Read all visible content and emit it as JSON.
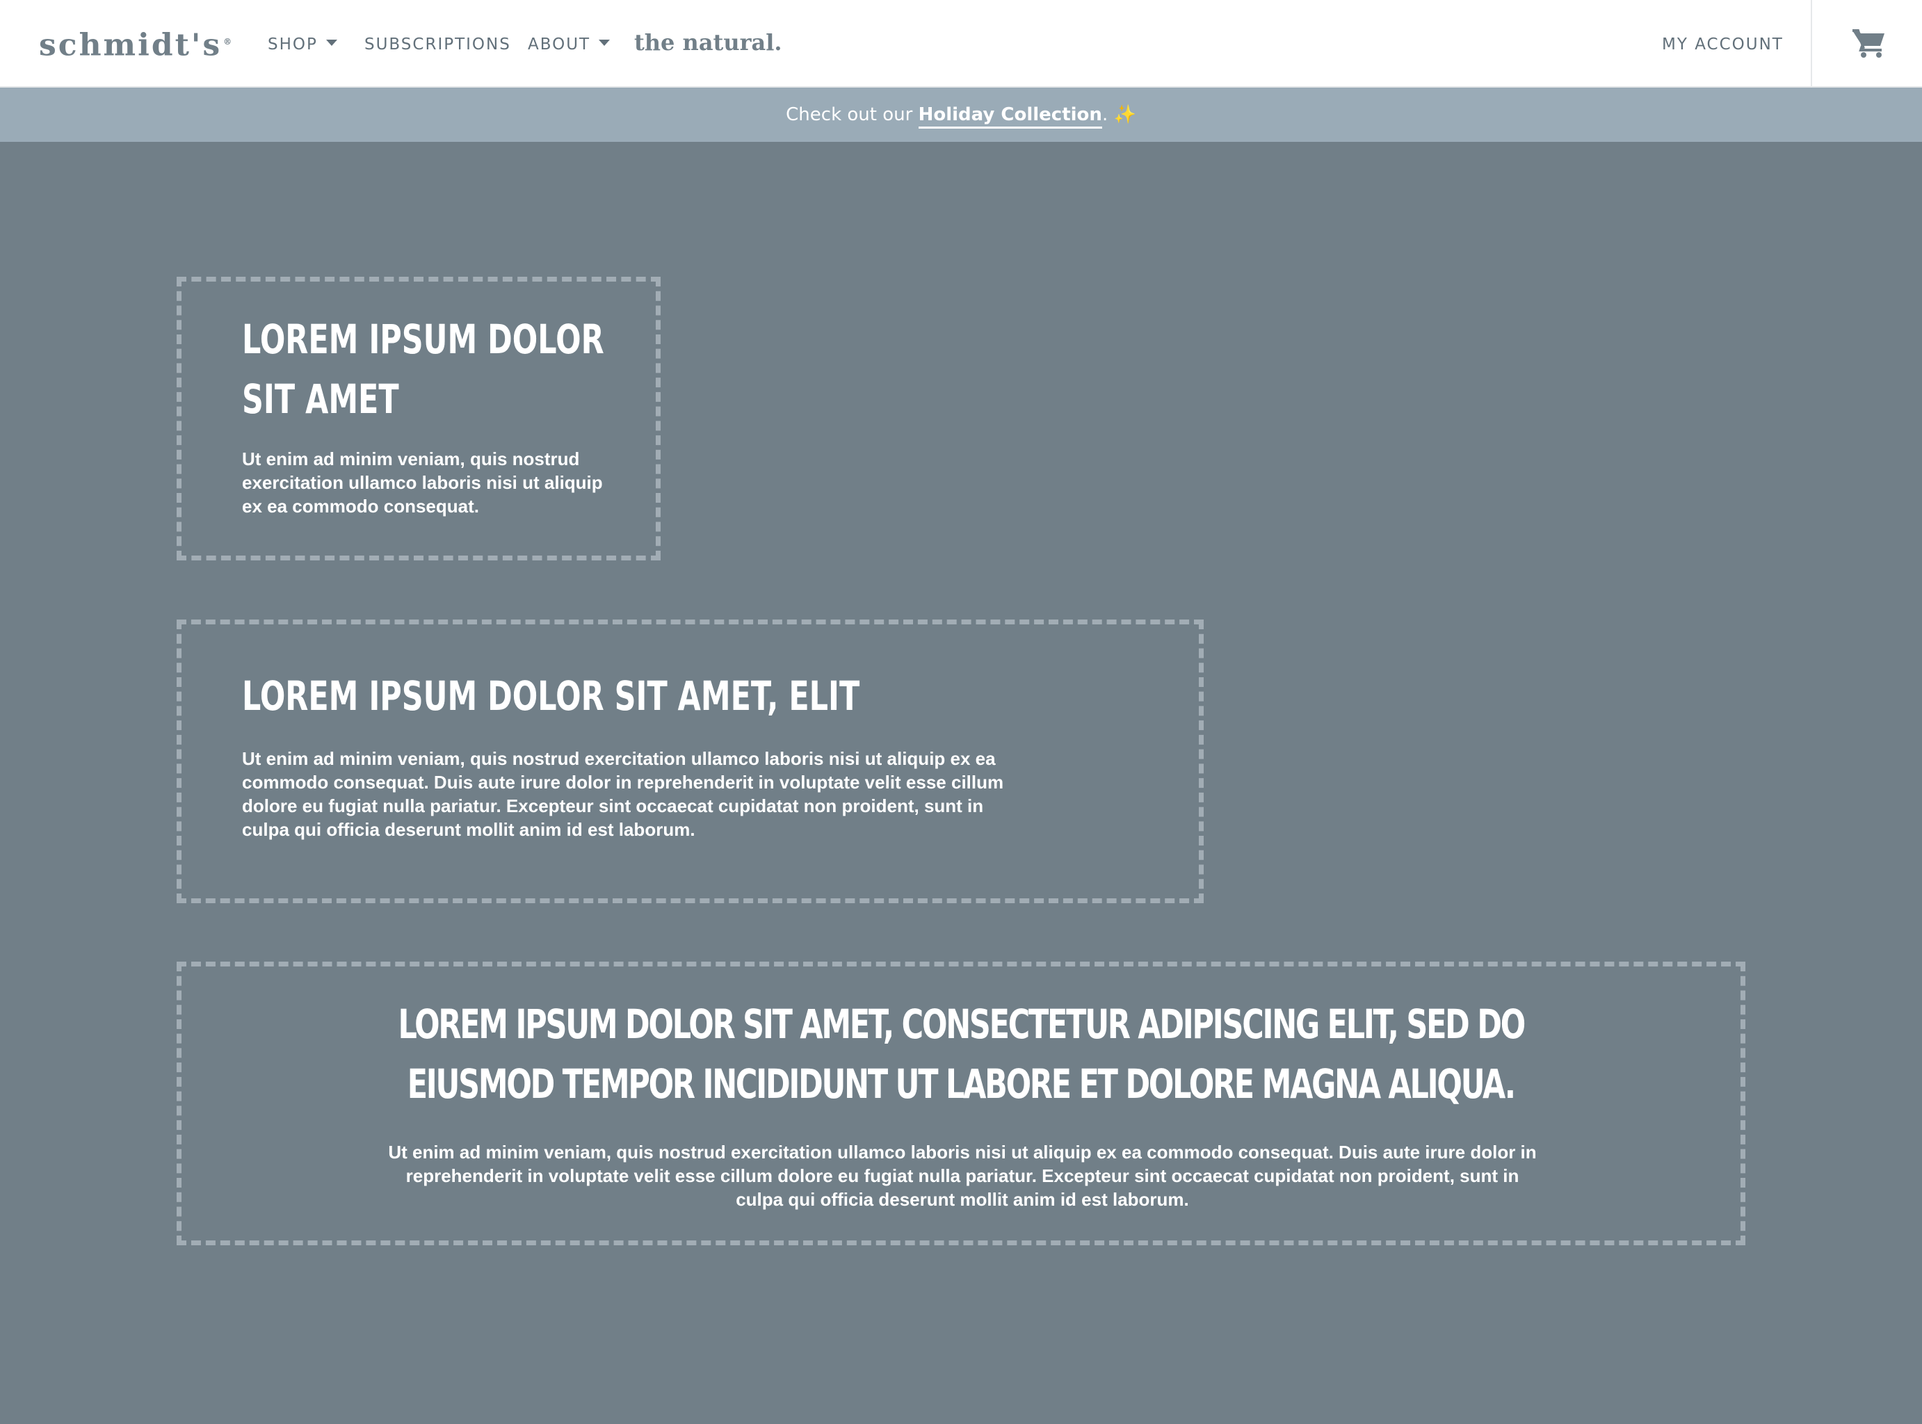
{
  "header": {
    "logo": "schmidt's",
    "logo_mark": "®",
    "nav": {
      "shop": "SHOP",
      "subscriptions": "SUBSCRIPTIONS",
      "about": "ABOUT"
    },
    "natural_link": "the natural.",
    "my_account": "MY ACCOUNT"
  },
  "announcement": {
    "prefix": "Check out our ",
    "link": "Holiday Collection",
    "suffix": ". ",
    "emoji": "✨"
  },
  "boxes": [
    {
      "title_line1": "LOREM IPSUM DOLOR",
      "title_line2": "SIT AMET",
      "body": "Ut enim ad minim veniam, quis nostrud exercitation ullamco laboris nisi ut aliquip ex ea commodo consequat."
    },
    {
      "title": "LOREM IPSUM DOLOR SIT AMET, ELIT",
      "body": "Ut enim ad minim veniam, quis nostrud exercitation ullamco laboris nisi ut aliquip ex ea commodo consequat. Duis aute irure dolor in reprehenderit in voluptate velit esse cillum dolore eu fugiat nulla pariatur. Excepteur sint occaecat cupidatat non proident, sunt in culpa qui officia deserunt mollit anim id est laborum."
    },
    {
      "title_line1": "LOREM IPSUM DOLOR SIT AMET, CONSECTETUR ADIPISCING ELIT, SED DO",
      "title_line2": "EIUSMOD TEMPOR INCIDIDUNT UT LABORE ET DOLORE MAGNA ALIQUA.",
      "body": "Ut enim ad minim veniam, quis nostrud exercitation ullamco laboris nisi ut aliquip ex ea commodo consequat. Duis aute irure dolor in reprehenderit in voluptate velit esse cillum dolore eu fugiat nulla pariatur. Excepteur sint occaecat cupidatat non proident, sunt in culpa qui officia deserunt mollit anim id est laborum."
    }
  ],
  "colors": {
    "background": "#717f88",
    "announcement_bar": "#9aabb7",
    "header_bg": "#ffffff",
    "nav_text": "#62707a",
    "box_border": "#a2adb5"
  },
  "icons": {
    "cart": "cart-icon"
  }
}
